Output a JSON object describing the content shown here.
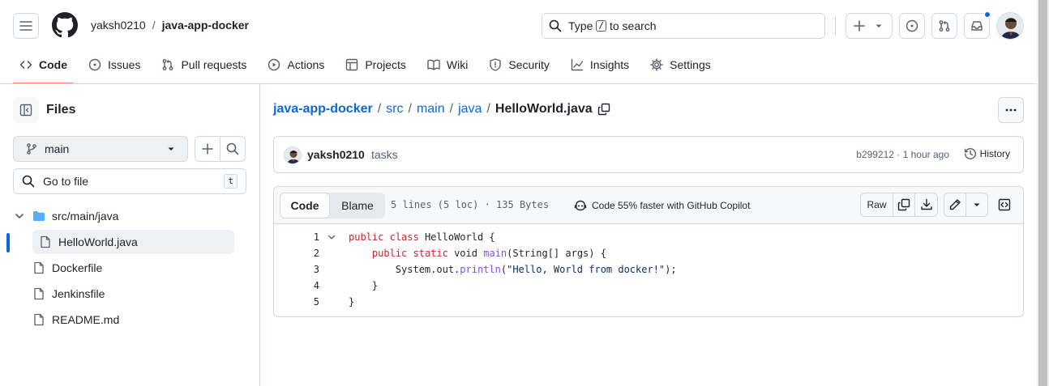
{
  "header": {
    "owner": "yaksh0210",
    "separator": "/",
    "repo": "java-app-docker",
    "search": {
      "prefix": "Type",
      "key": "/",
      "suffix": "to search"
    }
  },
  "tabs": [
    {
      "label": "Code",
      "icon": "code-icon",
      "active": true
    },
    {
      "label": "Issues",
      "icon": "issue-icon"
    },
    {
      "label": "Pull requests",
      "icon": "pull-request-icon"
    },
    {
      "label": "Actions",
      "icon": "play-icon"
    },
    {
      "label": "Projects",
      "icon": "table-icon"
    },
    {
      "label": "Wiki",
      "icon": "book-icon"
    },
    {
      "label": "Security",
      "icon": "shield-icon"
    },
    {
      "label": "Insights",
      "icon": "graph-icon"
    },
    {
      "label": "Settings",
      "icon": "gear-icon"
    }
  ],
  "sidebar": {
    "title": "Files",
    "branch": "main",
    "goto_placeholder": "Go to file",
    "goto_key": "t",
    "tree": [
      {
        "label": "src/main/java",
        "type": "folder"
      },
      {
        "label": "HelloWorld.java",
        "type": "file",
        "selected": true
      },
      {
        "label": "Dockerfile",
        "type": "file"
      },
      {
        "label": "Jenkinsfile",
        "type": "file"
      },
      {
        "label": "README.md",
        "type": "file"
      }
    ]
  },
  "breadcrumb": {
    "parts": [
      "java-app-docker",
      "src",
      "main",
      "java"
    ],
    "separator": "/",
    "file": "HelloWorld.java"
  },
  "commit": {
    "author": "yaksh0210",
    "message": "tasks",
    "meta": "b299212 · 1 hour ago",
    "history_label": "History"
  },
  "file_toolbar": {
    "code_tab": "Code",
    "blame_tab": "Blame",
    "info": "5 lines (5 loc) · 135 Bytes",
    "copilot": "Code 55% faster with GitHub Copilot",
    "raw": "Raw"
  },
  "code": {
    "line_numbers": [
      "1",
      "2",
      "3",
      "4",
      "5"
    ]
  },
  "colors": {
    "accent": "#0969da",
    "tab_underline": "#fd8c73",
    "notification": "#0969da",
    "keyword": "#cf222e",
    "function": "#8250df",
    "string": "#0a3069"
  }
}
